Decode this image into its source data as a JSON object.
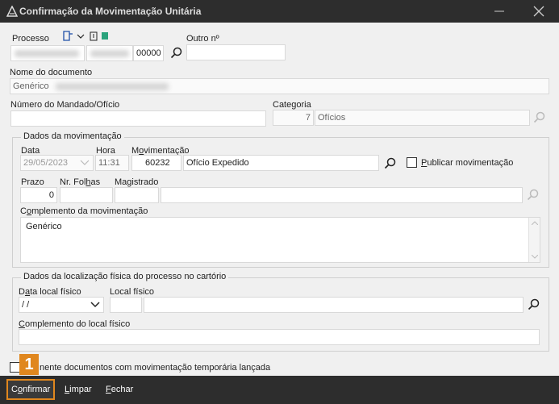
{
  "window": {
    "title": "Confirmação da Movimentação Unitária"
  },
  "processo": {
    "label": "Processo",
    "number_suffix": "00000",
    "outro_label": "Outro nº",
    "outro_value": ""
  },
  "documento": {
    "label": "Nome do documento",
    "value": "Genérico"
  },
  "mandado": {
    "label": "Número do Mandado/Ofício",
    "value": ""
  },
  "categoria": {
    "label": "Categoria",
    "code": "7",
    "name": "Ofícios"
  },
  "movimentacao": {
    "group_title": "Dados da movimentação",
    "data_label": "Data",
    "data_value": "29/05/2023",
    "hora_label": "Hora",
    "hora_value": "11:31",
    "mov_label": "Movimentação",
    "mov_code": "60232",
    "mov_name": "Ofício Expedido",
    "publicar_label": "Publicar movimentação",
    "prazo_label": "Prazo",
    "prazo_value": "0",
    "folhas_label": "Nr. Folhas",
    "folhas_value": "",
    "magistrado_label": "Magistrado",
    "magistrado_code": "",
    "magistrado_name": "",
    "complemento_label": "Complemento da movimentação",
    "complemento_value": "Genérico"
  },
  "localizacao": {
    "group_title": "Dados da localização física do processo no cartório",
    "data_label": "Data local físico",
    "data_value": " /  /",
    "local_label": "Local físico",
    "local_code": "",
    "local_name": "",
    "complemento_label": "Complemento do local físico",
    "complemento_value": ""
  },
  "somente": {
    "label": "nente documentos com movimentação temporária lançada"
  },
  "badge": "1",
  "buttons": {
    "confirmar": "Confirmar",
    "limpar": "Limpar",
    "fechar": "Fechar"
  }
}
